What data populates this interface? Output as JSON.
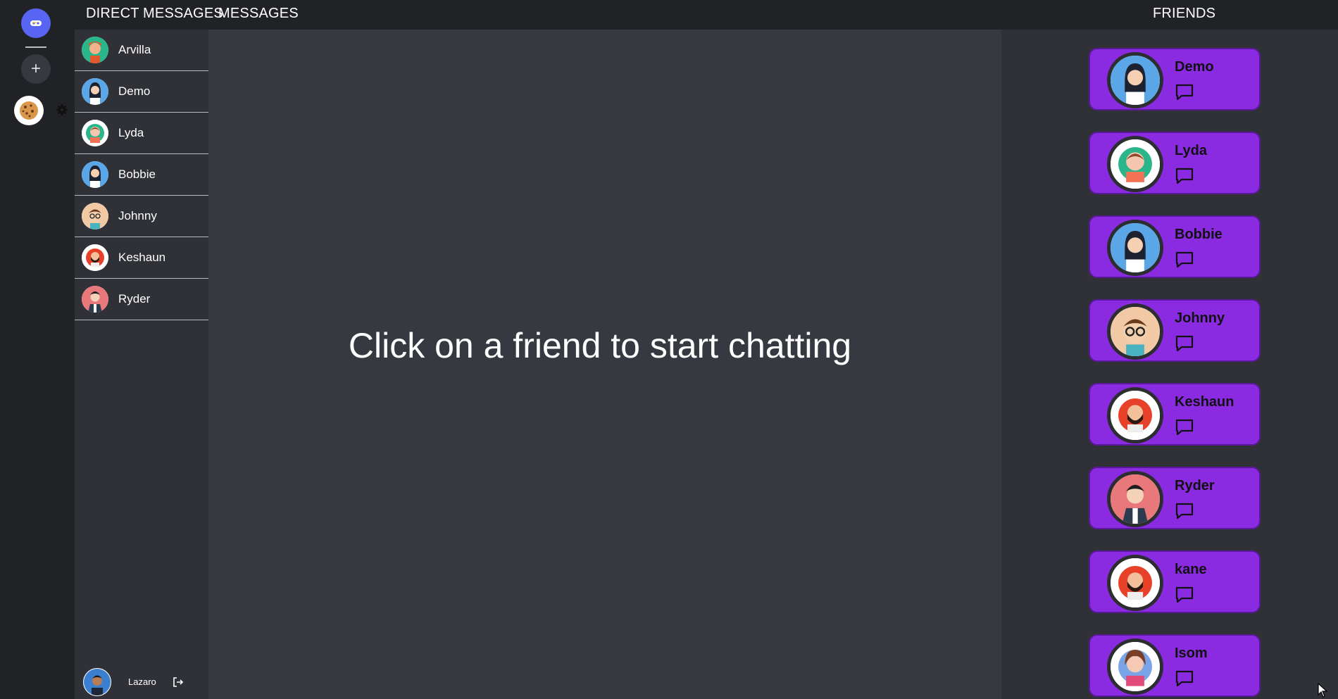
{
  "header": {
    "direct_messages": "DIRECT MESSAGES",
    "messages": "MESSAGES",
    "friends": "FRIENDS"
  },
  "servers": {
    "add_label": "+"
  },
  "dm_list": [
    {
      "name": "Arvilla",
      "avatar": "green"
    },
    {
      "name": "Demo",
      "avatar": "blue-girl"
    },
    {
      "name": "Lyda",
      "avatar": "teal-girl"
    },
    {
      "name": "Bobbie",
      "avatar": "blue-girl"
    },
    {
      "name": "Johnny",
      "avatar": "glasses-boy"
    },
    {
      "name": "Keshaun",
      "avatar": "red-beard"
    },
    {
      "name": "Ryder",
      "avatar": "pink-man"
    }
  ],
  "user": {
    "name": "Lazaro"
  },
  "main": {
    "placeholder": "Click on a friend to start chatting"
  },
  "friends": [
    {
      "name": "Demo"
    },
    {
      "name": "Lyda"
    },
    {
      "name": "Bobbie"
    },
    {
      "name": "Johnny"
    },
    {
      "name": "Keshaun"
    },
    {
      "name": "Ryder"
    },
    {
      "name": "kane"
    },
    {
      "name": "Isom"
    }
  ],
  "colors": {
    "accent": "#5865f2",
    "card": "#8a2be2",
    "background": "#36393f",
    "sidebar": "#2f3136",
    "rail": "#202225"
  }
}
